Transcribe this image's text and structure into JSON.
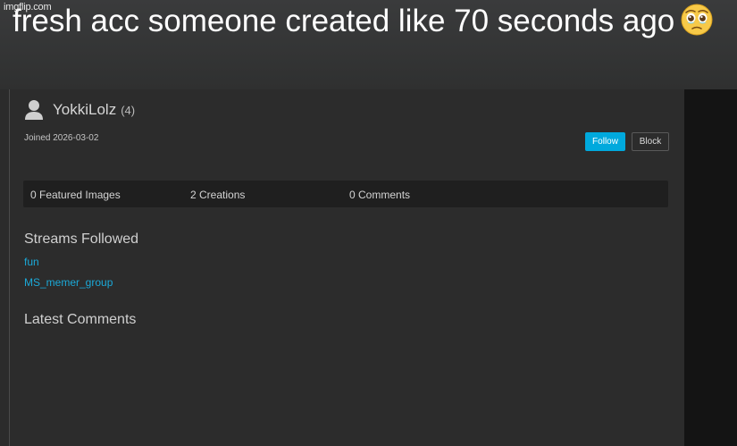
{
  "meme": {
    "watermark": "imgflip.com",
    "caption": "fresh acc someone created like 70 seconds ago",
    "emoji_icon": "face-holding-back-tears-icon"
  },
  "profile": {
    "username": "YokkiLolz",
    "points": "(4)",
    "joined": "Joined 2026-03-02",
    "follow_label": "Follow",
    "block_label": "Block",
    "accent_color": "#00a9dd"
  },
  "stats": {
    "featured": "0 Featured Images",
    "creations": "2 Creations",
    "comments": "0 Comments"
  },
  "streams": {
    "title": "Streams Followed",
    "items": [
      "fun",
      "MS_memer_group"
    ]
  },
  "latest_comments": {
    "title": "Latest Comments"
  }
}
